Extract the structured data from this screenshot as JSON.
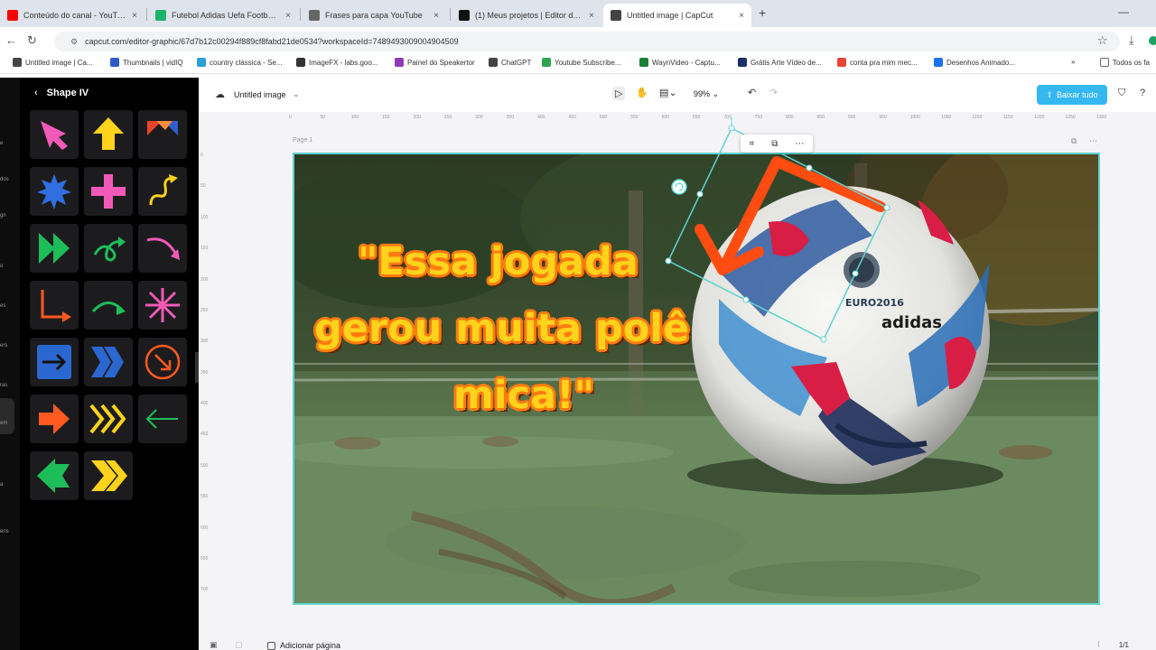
{
  "browser": {
    "tabs": [
      {
        "title": "Conteúdo do canal - YouTube S",
        "icon": "youtube-icon",
        "color": "#ff0000"
      },
      {
        "title": "Futebol Adidas Uefa Football ·",
        "icon": "freepik-icon",
        "color": "#1cb36b"
      },
      {
        "title": "Frases para capa YouTube",
        "icon": "globe-icon",
        "color": "#666666"
      },
      {
        "title": "(1) Meus projetos | Editor de v",
        "icon": "capcut-icon",
        "color": "#111111"
      },
      {
        "title": "Untitled image | CapCut",
        "icon": "globe-icon",
        "color": "#444444"
      }
    ],
    "url": "capcut.com/editor-graphic/67d7b12c00294f889cf8fabd21de0534?workspaceId=7489493009004904509",
    "bookmarks": [
      {
        "label": "Untitled image | Ca...",
        "color": "#444444"
      },
      {
        "label": "Thumbnails | vidIQ",
        "color": "#2e5ac8"
      },
      {
        "label": "country clássica - Se...",
        "color": "#2e9fd6"
      },
      {
        "label": "ImageFX - labs.goo...",
        "color": "#333333"
      },
      {
        "label": "Painel do Speakertor",
        "color": "#8f3bb8"
      },
      {
        "label": "ChatGPT",
        "color": "#444444"
      },
      {
        "label": "Youtube Subscribe...",
        "color": "#2ea44f"
      },
      {
        "label": "WaynVideo - Captu...",
        "color": "#1a7f37"
      },
      {
        "label": "Grátis Arte Vídeo de...",
        "color": "#1b2f6b"
      },
      {
        "label": "conta pra mim mec...",
        "color": "#ea4335"
      },
      {
        "label": "Desenhos Animado...",
        "color": "#1a73e8"
      }
    ],
    "all_bookmarks": "Todos os fa"
  },
  "sidebar": {
    "rail_labels": [
      "e",
      "dos",
      "gn",
      "o",
      "es",
      "ers",
      "ras",
      "em",
      "a",
      "ens"
    ],
    "panel_title": "Shape IV",
    "shapes": [
      "diagonal-arrow-pink-icon",
      "up-arrow-yellow-icon",
      "triangles-red-blue-icon",
      "starburst-blue-icon",
      "plus-pink-icon",
      "curly-arrow-yellow-icon",
      "double-play-green-icon",
      "loop-arrow-green-icon",
      "curved-arrow-pink-icon",
      "elbow-arrow-orange-icon",
      "swoosh-arrow-green-icon",
      "asterisk-pink-icon",
      "square-arrow-blue-icon",
      "chevrons-blue-icon",
      "circle-arrow-orange-icon",
      "arrow-orange-icon",
      "chevrons-yellow-icon",
      "thin-arrow-green-icon",
      "arrow-left-green-icon",
      "chevrons-yellow-bold-icon"
    ]
  },
  "editor": {
    "doc_title": "Untitled image",
    "zoom": "99%",
    "export_label": "Baixar tudo",
    "page_label": "Page 1",
    "headline_lines": [
      "\"Essa jogada",
      "gerou muita polê",
      "mica!\""
    ],
    "add_page_label": "Adicionar página",
    "page_count": "1/1",
    "ruler_h": [
      "0",
      "50",
      "100",
      "150",
      "200",
      "250",
      "300",
      "350",
      "400",
      "450",
      "500",
      "550",
      "600",
      "650",
      "700",
      "750",
      "800",
      "850",
      "900",
      "950",
      "1000",
      "1050",
      "1100",
      "1150",
      "1200",
      "1250",
      "1300"
    ],
    "ruler_v": [
      "0",
      "50",
      "100",
      "150",
      "200",
      "250",
      "300",
      "350",
      "400",
      "450",
      "500",
      "550",
      "600",
      "650",
      "700"
    ],
    "colors": {
      "selection": "#5ed3d0",
      "accent_button": "#35b8f0",
      "arrow": "#ff4d12",
      "headline_fill": "#ffd21c",
      "headline_stroke": "#ff7b10"
    }
  }
}
